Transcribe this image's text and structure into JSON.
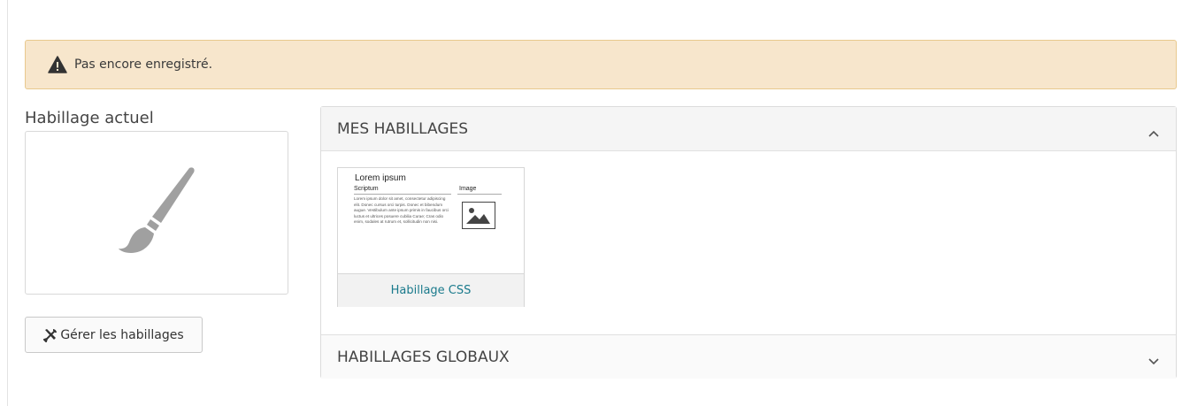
{
  "alert": {
    "icon": "warning-triangle-icon",
    "text": "Pas encore enregistré.",
    "bg_color": "#f7e6cc"
  },
  "current_skin": {
    "label": "Habillage actuel",
    "icon": "paintbrush-icon"
  },
  "manage_button": {
    "icon": "tools-icon",
    "label": "Gérer les habillages"
  },
  "my_skins": {
    "title": "MES HABILLAGES",
    "expanded": true,
    "items": [
      {
        "name": "Habillage CSS",
        "thumbnail": {
          "title": "Lorem ipsum",
          "col1_heading": "Scriptum",
          "col2_heading": "Image",
          "body": "Lorem ipsum dolor sit amet, consectetur adipiscing elit. Donec cursus orci turpis. Donec et bibendum augue. Vestibulum ante ipsum primis in faucibus orci luctus et ultrices posuere cubilia Curae; Cras odio enim, sodales at rutrum et, sollicitudin non nisi.",
          "image_icon": "image-placeholder-icon"
        }
      }
    ]
  },
  "global_skins": {
    "title": "HABILLAGES GLOBAUX",
    "expanded": false
  },
  "colors": {
    "accent": "#1a7a8c",
    "panel_header_bg": "#f5f5f5",
    "icon_gray": "#a0a0a0"
  }
}
